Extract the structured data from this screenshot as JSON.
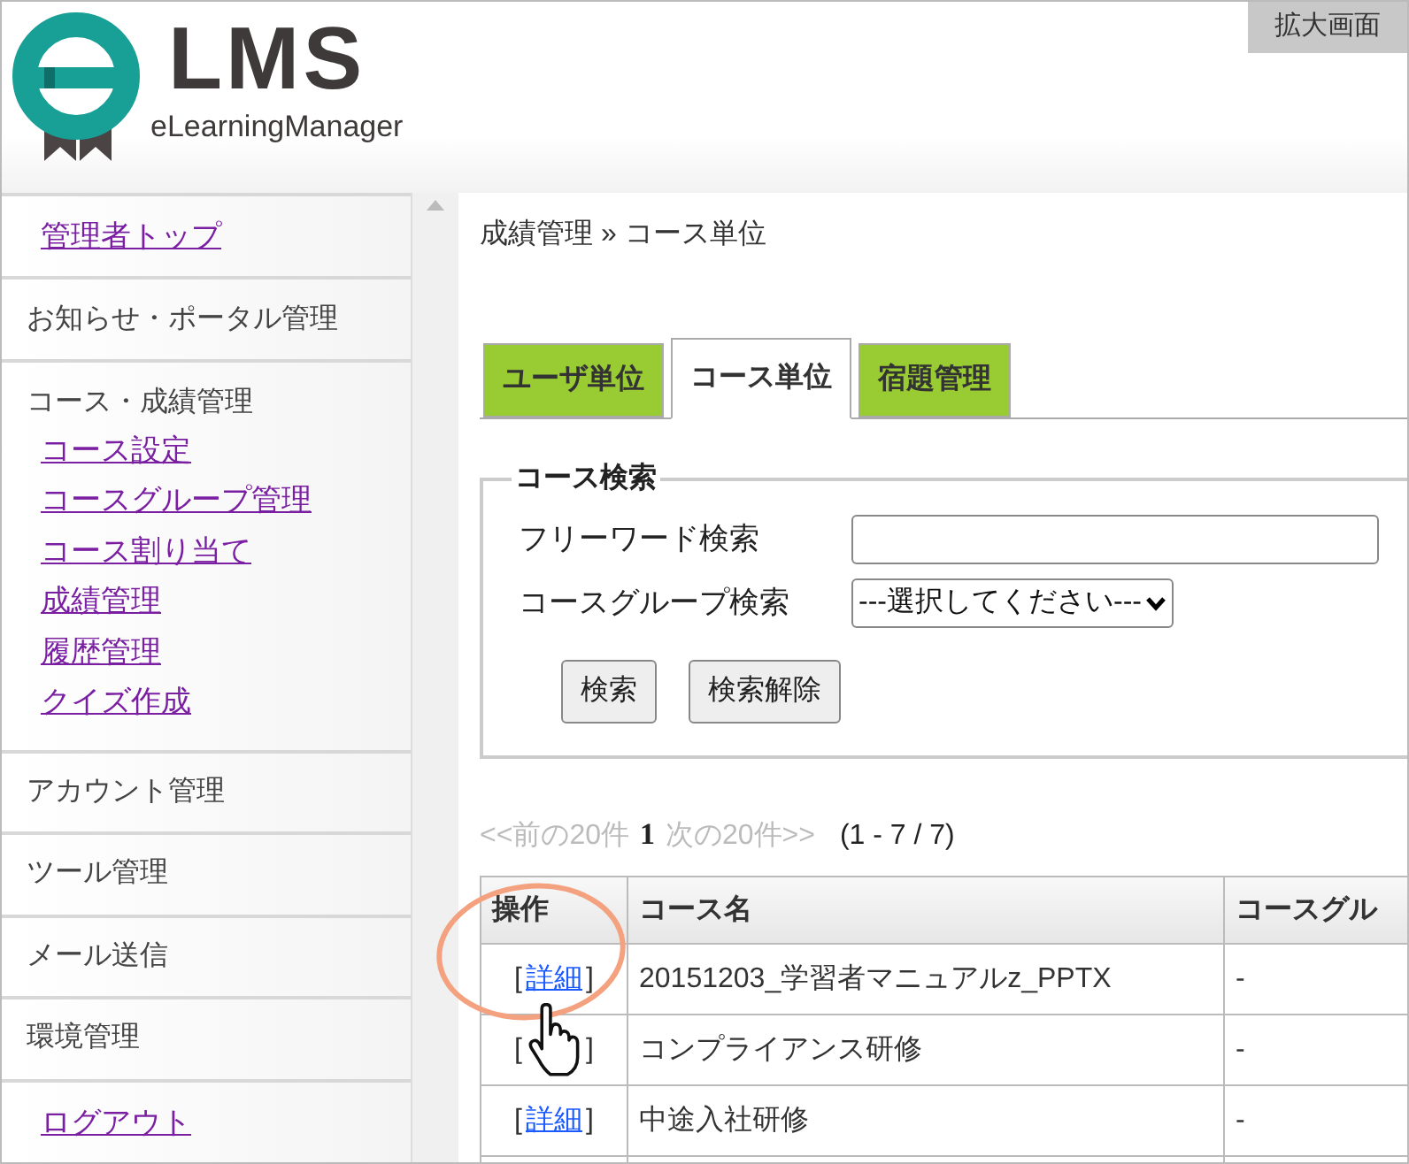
{
  "badge": "拡大画面",
  "logo": {
    "mark": "LMS",
    "tagline": "eLearningManager"
  },
  "sidebar": {
    "items": [
      {
        "kind": "link",
        "label": "管理者トップ"
      },
      {
        "kind": "heading",
        "label": "お知らせ・ポータル管理"
      },
      {
        "kind": "group",
        "label": "コース・成績管理",
        "children": [
          {
            "label": "コース設定"
          },
          {
            "label": "コースグループ管理"
          },
          {
            "label": "コース割り当て"
          },
          {
            "label": "成績管理"
          },
          {
            "label": "履歴管理"
          },
          {
            "label": "クイズ作成"
          }
        ]
      },
      {
        "kind": "heading",
        "label": "アカウント管理"
      },
      {
        "kind": "heading",
        "label": "ツール管理"
      },
      {
        "kind": "heading",
        "label": "メール送信"
      },
      {
        "kind": "heading",
        "label": "環境管理"
      },
      {
        "kind": "link",
        "label": "ログアウト"
      }
    ]
  },
  "breadcrumb": "成績管理 » コース単位",
  "tabs": [
    {
      "label": "ユーザ単位",
      "selected": false
    },
    {
      "label": "コース単位",
      "selected": true
    },
    {
      "label": "宿題管理",
      "selected": false
    }
  ],
  "search": {
    "legend": "コース検索",
    "fields": [
      {
        "kind": "text",
        "label": "フリーワード検索"
      },
      {
        "kind": "select",
        "label": "コースグループ検索",
        "value": "---選択してください---"
      }
    ],
    "buttons": [
      "検索",
      "検索解除"
    ]
  },
  "pager": {
    "prev": "<<前の20件",
    "current": "1",
    "next": "次の20件>>",
    "range": "(1 - 7 / 7)"
  },
  "table": {
    "columns": [
      "操作",
      "コース名",
      "コースグル"
    ],
    "rows": [
      {
        "open": "[",
        "action": "詳細",
        "close": "]",
        "name": "20151203_学習者マニュアルz_PPTX",
        "group": "-"
      },
      {
        "open": "[",
        "close": "]",
        "name": "コンプライアンス研修",
        "group": "-"
      },
      {
        "open": "[",
        "action": "詳細",
        "close": "]",
        "name": "中途入社研修",
        "group": "-"
      }
    ]
  }
}
